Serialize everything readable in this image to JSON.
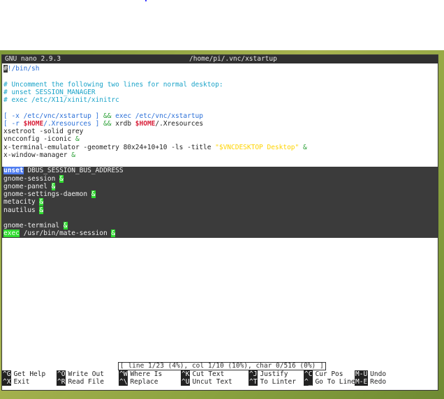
{
  "window": {
    "app": "GNU nano 2.9.3",
    "path": "/home/pi/.vnc/xstartup"
  },
  "editor_lines": [
    {
      "segments": [
        {
          "t": "#",
          "cls": "cursor"
        },
        {
          "t": "!/bin/sh",
          "cls": "blu"
        }
      ]
    },
    {
      "segments": []
    },
    {
      "segments": [
        {
          "t": "# Uncomment the following two lines for normal desktop:",
          "cls": "c"
        }
      ]
    },
    {
      "segments": [
        {
          "t": "# unset SESSION_MANAGER",
          "cls": "c"
        }
      ]
    },
    {
      "segments": [
        {
          "t": "# exec /etc/X11/xinit/xinitrc",
          "cls": "c"
        }
      ]
    },
    {
      "segments": []
    },
    {
      "segments": [
        {
          "t": "[ -x /etc/vnc/xstartup ] ",
          "cls": "blu"
        },
        {
          "t": "&& ",
          "cls": "grn"
        },
        {
          "t": "exec /etc/vnc/xstartup",
          "cls": "blu"
        }
      ]
    },
    {
      "segments": [
        {
          "t": "[ -r ",
          "cls": "blu"
        },
        {
          "t": "$HOME",
          "cls": "red"
        },
        {
          "t": "/.Xresources ] ",
          "cls": "blu"
        },
        {
          "t": "&& ",
          "cls": "grn"
        },
        {
          "t": "xrdb ",
          "cls": "blk"
        },
        {
          "t": "$HOME",
          "cls": "red"
        },
        {
          "t": "/.Xresources",
          "cls": "blk"
        }
      ]
    },
    {
      "segments": [
        {
          "t": "xsetroot -solid grey",
          "cls": "blk"
        }
      ]
    },
    {
      "segments": [
        {
          "t": "vncconfig -iconic ",
          "cls": "blk"
        },
        {
          "t": "&",
          "cls": "grn"
        }
      ]
    },
    {
      "segments": [
        {
          "t": "x-terminal-emulator -geometry 80x24+10+10 -ls -title ",
          "cls": "blk"
        },
        {
          "t": "\"$VNCDESKTOP Desktop\"",
          "cls": "yel"
        },
        {
          "t": " &",
          "cls": "grn"
        }
      ]
    },
    {
      "segments": [
        {
          "t": "x-window-manager ",
          "cls": "blk"
        },
        {
          "t": "&",
          "cls": "grn"
        }
      ]
    },
    {
      "segments": []
    },
    {
      "sel": true,
      "segments": [
        {
          "t": "unset",
          "cls": "kw"
        },
        {
          "t": " DBUS_SESSION_BUS_ADDRESS",
          "cls": ""
        }
      ]
    },
    {
      "sel": true,
      "segments": [
        {
          "t": "gnome-session ",
          "cls": ""
        },
        {
          "t": "&",
          "cls": "grnbg"
        }
      ]
    },
    {
      "sel": true,
      "segments": [
        {
          "t": "gnome-panel ",
          "cls": ""
        },
        {
          "t": "&",
          "cls": "grnbg"
        }
      ]
    },
    {
      "sel": true,
      "segments": [
        {
          "t": "gnome-settings-daemon ",
          "cls": ""
        },
        {
          "t": "&",
          "cls": "grnbg"
        }
      ]
    },
    {
      "sel": true,
      "segments": [
        {
          "t": "metacity ",
          "cls": ""
        },
        {
          "t": "&",
          "cls": "grnbg"
        }
      ]
    },
    {
      "sel": true,
      "segments": [
        {
          "t": "nautilus ",
          "cls": ""
        },
        {
          "t": "&",
          "cls": "grnbg"
        }
      ]
    },
    {
      "sel": true,
      "segments": []
    },
    {
      "sel": true,
      "segments": [
        {
          "t": "gnome-terminal ",
          "cls": ""
        },
        {
          "t": "&",
          "cls": "grnbg"
        }
      ]
    },
    {
      "sel": true,
      "segments": [
        {
          "t": "exec",
          "cls": "grnbg"
        },
        {
          "t": " /usr/bin/mate-session ",
          "cls": ""
        },
        {
          "t": "&",
          "cls": "grnbg"
        }
      ]
    }
  ],
  "status": "[ line 1/23 (4%), col 1/10 (10%), char 0/516 (0%) ]",
  "shortcuts": {
    "row1": [
      {
        "key": "^G",
        "label": "Get Help"
      },
      {
        "key": "^O",
        "label": "Write Out"
      },
      {
        "key": "^W",
        "label": "Where Is"
      },
      {
        "key": "^K",
        "label": "Cut Text"
      },
      {
        "key": "^J",
        "label": "Justify"
      },
      {
        "key": "^C",
        "label": "Cur Pos"
      },
      {
        "key": "M-U",
        "label": "Undo"
      }
    ],
    "row2": [
      {
        "key": "^X",
        "label": "Exit"
      },
      {
        "key": "^R",
        "label": "Read File"
      },
      {
        "key": "^\\",
        "label": "Replace"
      },
      {
        "key": "^U",
        "label": "Uncut Text"
      },
      {
        "key": "^T",
        "label": "To Linter"
      },
      {
        "key": "^_",
        "label": "Go To Line"
      },
      {
        "key": "M-E",
        "label": "Redo"
      }
    ]
  }
}
